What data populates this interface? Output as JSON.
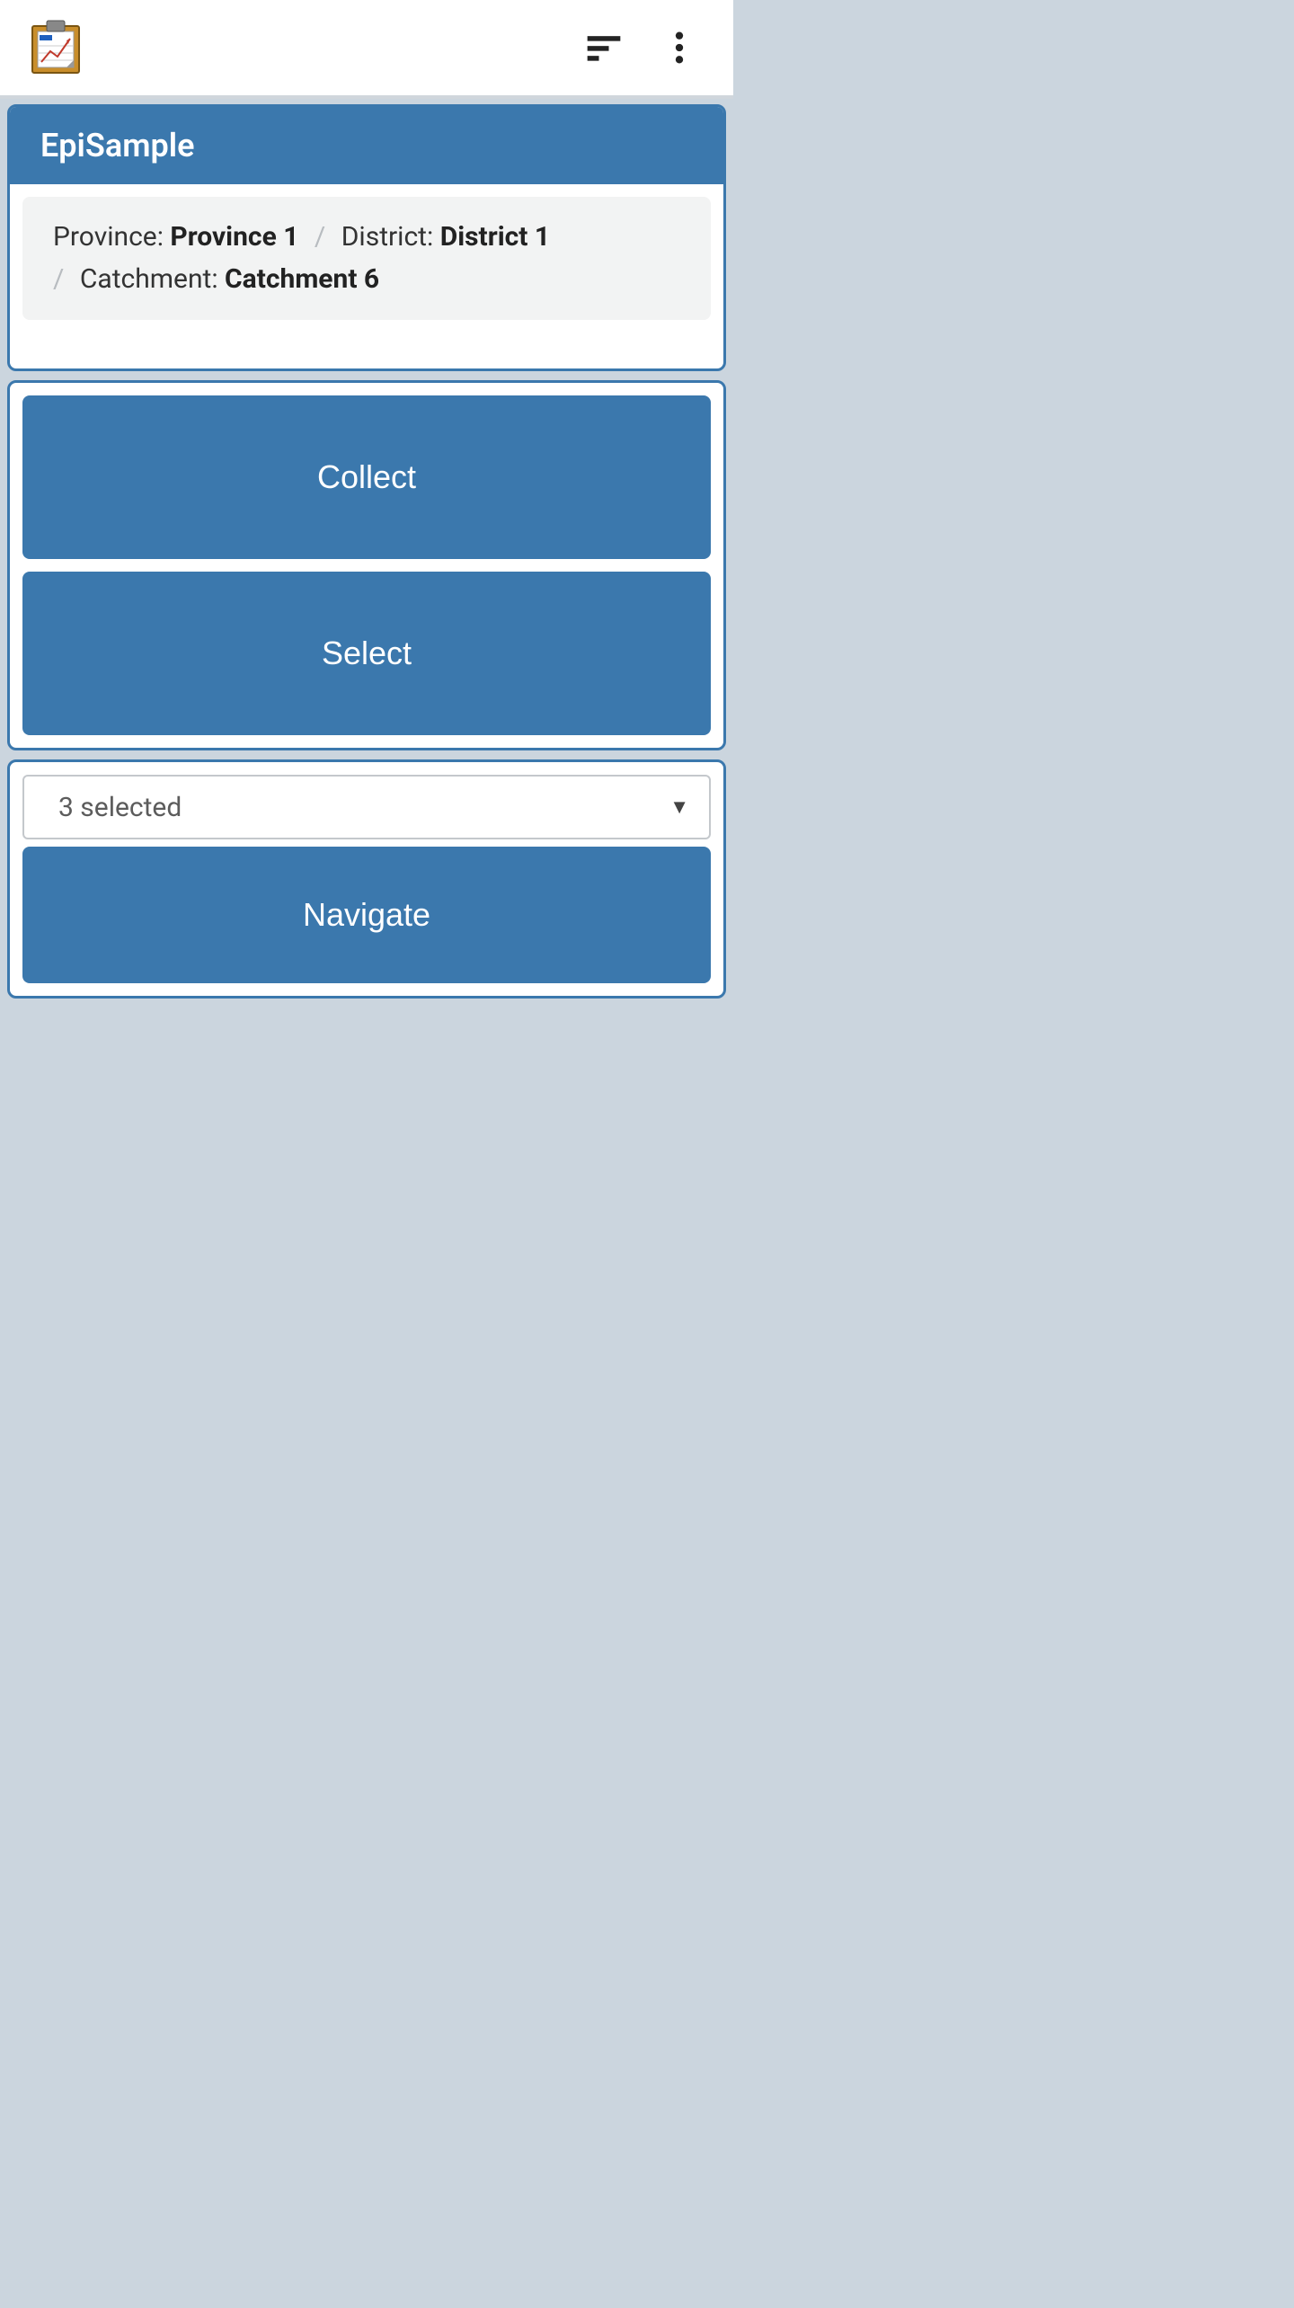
{
  "header": {
    "title": "EpiSample"
  },
  "breadcrumb": {
    "province_label": "Province: ",
    "province_value": "Province 1",
    "district_label": "District: ",
    "district_value": "District 1",
    "catchment_label": "Catchment: ",
    "catchment_value": "Catchment 6"
  },
  "actions": {
    "collect_label": "Collect",
    "select_label": "Select"
  },
  "nav": {
    "dropdown_value": "3 selected",
    "navigate_label": "Navigate"
  },
  "icons": {
    "logo": "clipboard-chart-icon",
    "sort": "sort-icon",
    "overflow": "more-vert-icon"
  }
}
